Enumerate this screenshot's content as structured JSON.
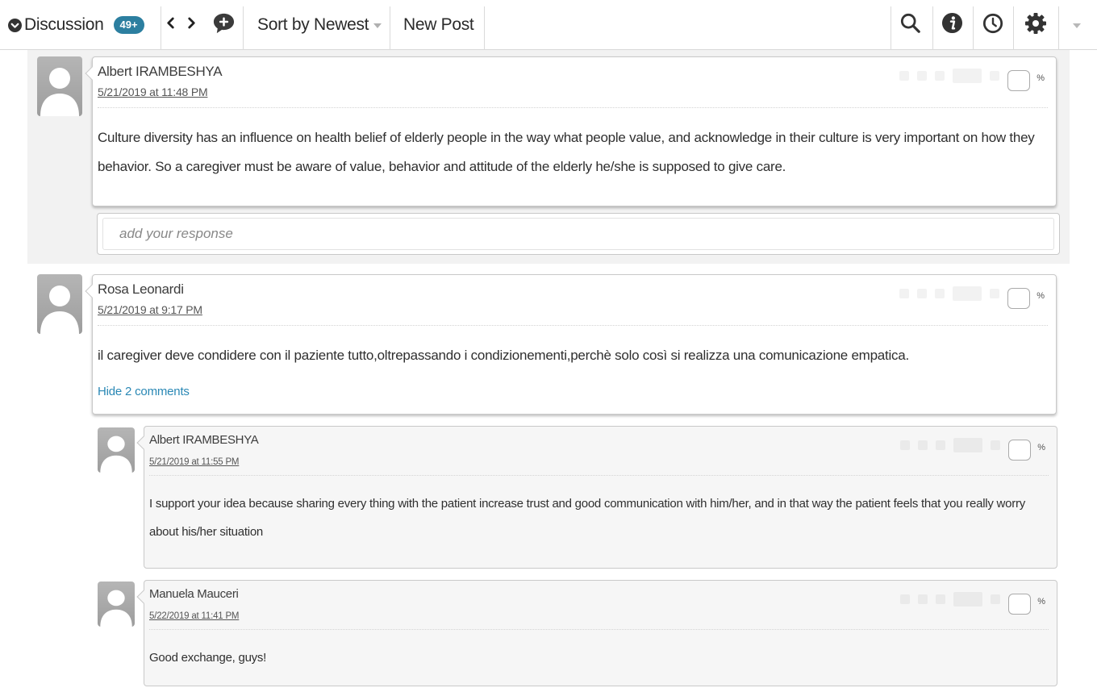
{
  "toolbar": {
    "title": "Discussion",
    "count_badge": "49+",
    "sort_label": "Sort by Newest",
    "new_post_label": "New Post"
  },
  "colors": {
    "accent": "#2c7fa0",
    "link": "#2a88b5",
    "card_border": "#c9c9c9"
  },
  "icons": {
    "collapse": "chevron-down-circle-icon",
    "prev": "chevron-left-icon",
    "next": "chevron-right-icon",
    "add_comment": "speech-bubble-plus-icon",
    "search": "search-icon",
    "info": "info-icon",
    "history": "clock-icon",
    "settings": "gear-icon",
    "more": "caret-down-icon"
  },
  "posts": [
    {
      "author": "Albert IRAMBESHYA",
      "date": "5/21/2019 at 11:48 PM",
      "text": "Culture diversity has an influence on health belief of elderly people in the way what people value, and acknowledge in their culture is very important on how they behavior. So a caregiver must be aware of value, behavior and attitude of the elderly he/she is supposed to give care.",
      "percent_label": "%",
      "response_placeholder": "add your response"
    },
    {
      "author": "Rosa Leonardi",
      "date": "5/21/2019 at 9:17 PM",
      "text": "il caregiver deve condidere con il paziente tutto,oltrepassando i condizionementi,perchè solo così si realizza una comunicazione empatica.",
      "percent_label": "%",
      "toggle_comments": "Hide 2 comments",
      "replies": [
        {
          "author": "Albert IRAMBESHYA",
          "date": "5/21/2019 at 11:55 PM",
          "text": "I support your idea because sharing every thing with the patient increase trust and good communication with him/her, and in that way the patient feels that you really worry about his/her  situation",
          "percent_label": "%"
        },
        {
          "author": "Manuela Mauceri",
          "date": "5/22/2019 at 11:41 PM",
          "text": "Good exchange, guys!",
          "percent_label": "%"
        }
      ]
    }
  ]
}
